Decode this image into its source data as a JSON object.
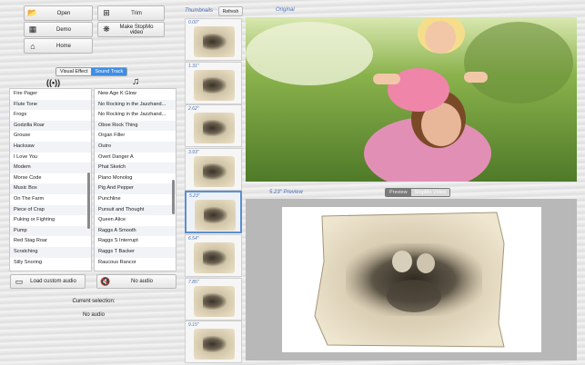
{
  "toolbar": {
    "open": "Open",
    "trim": "Trim",
    "demo": "Demo",
    "make": "Make StopMo video",
    "home": "Home"
  },
  "tabs": {
    "visual": "Visual Effect",
    "sound": "Sound Track"
  },
  "effects_list": [
    "Fire Pager",
    "Flute Tone",
    "Frogs",
    "Godzilla Roar",
    "Grouse",
    "Hacksaw",
    "I Love You",
    "Modem",
    "Morse Code",
    "Music Box",
    "On The Farm",
    "Piece of Crap",
    "Puking or Fighting",
    "Pump",
    "Red Stag Roar",
    "Scratching",
    "Silly Snoring"
  ],
  "music_list": [
    "New Age K Glow",
    "No Rocking in the Jazzhand...",
    "No Rocking in the Jazzhand...",
    "Oboe Rock Thing",
    "Organ Filler",
    "Outro",
    "Overt Danger A",
    "Phat Sketch",
    "Piano Monolog",
    "Pig And Pepper",
    "Punchline",
    "Pursuit and Thought",
    "Queen Alice",
    "Raggs A Smooth",
    "Raggs S Interrupt",
    "Raggs T Backer",
    "Raucous Rancor"
  ],
  "audio": {
    "load": "Load custom audio",
    "no_audio": "No audio",
    "current_label": "Current selection:",
    "current_value": "No audio"
  },
  "thumbnails": {
    "label": "Thumbnails",
    "refresh": "Refresh",
    "times": [
      "0.00\"",
      "1.31\"",
      "2.62\"",
      "3.93\"",
      "5.23\"",
      "6.54\"",
      "7.85\"",
      "9.15\""
    ],
    "selected_index": 4
  },
  "original": {
    "label": "Original"
  },
  "preview": {
    "label": "5.23\" Preview",
    "tab_preview": "Preview",
    "tab_stopmo": "StopMo Video"
  },
  "colors": {
    "accent": "#3d8ee6",
    "time_label": "#4a72b8"
  }
}
